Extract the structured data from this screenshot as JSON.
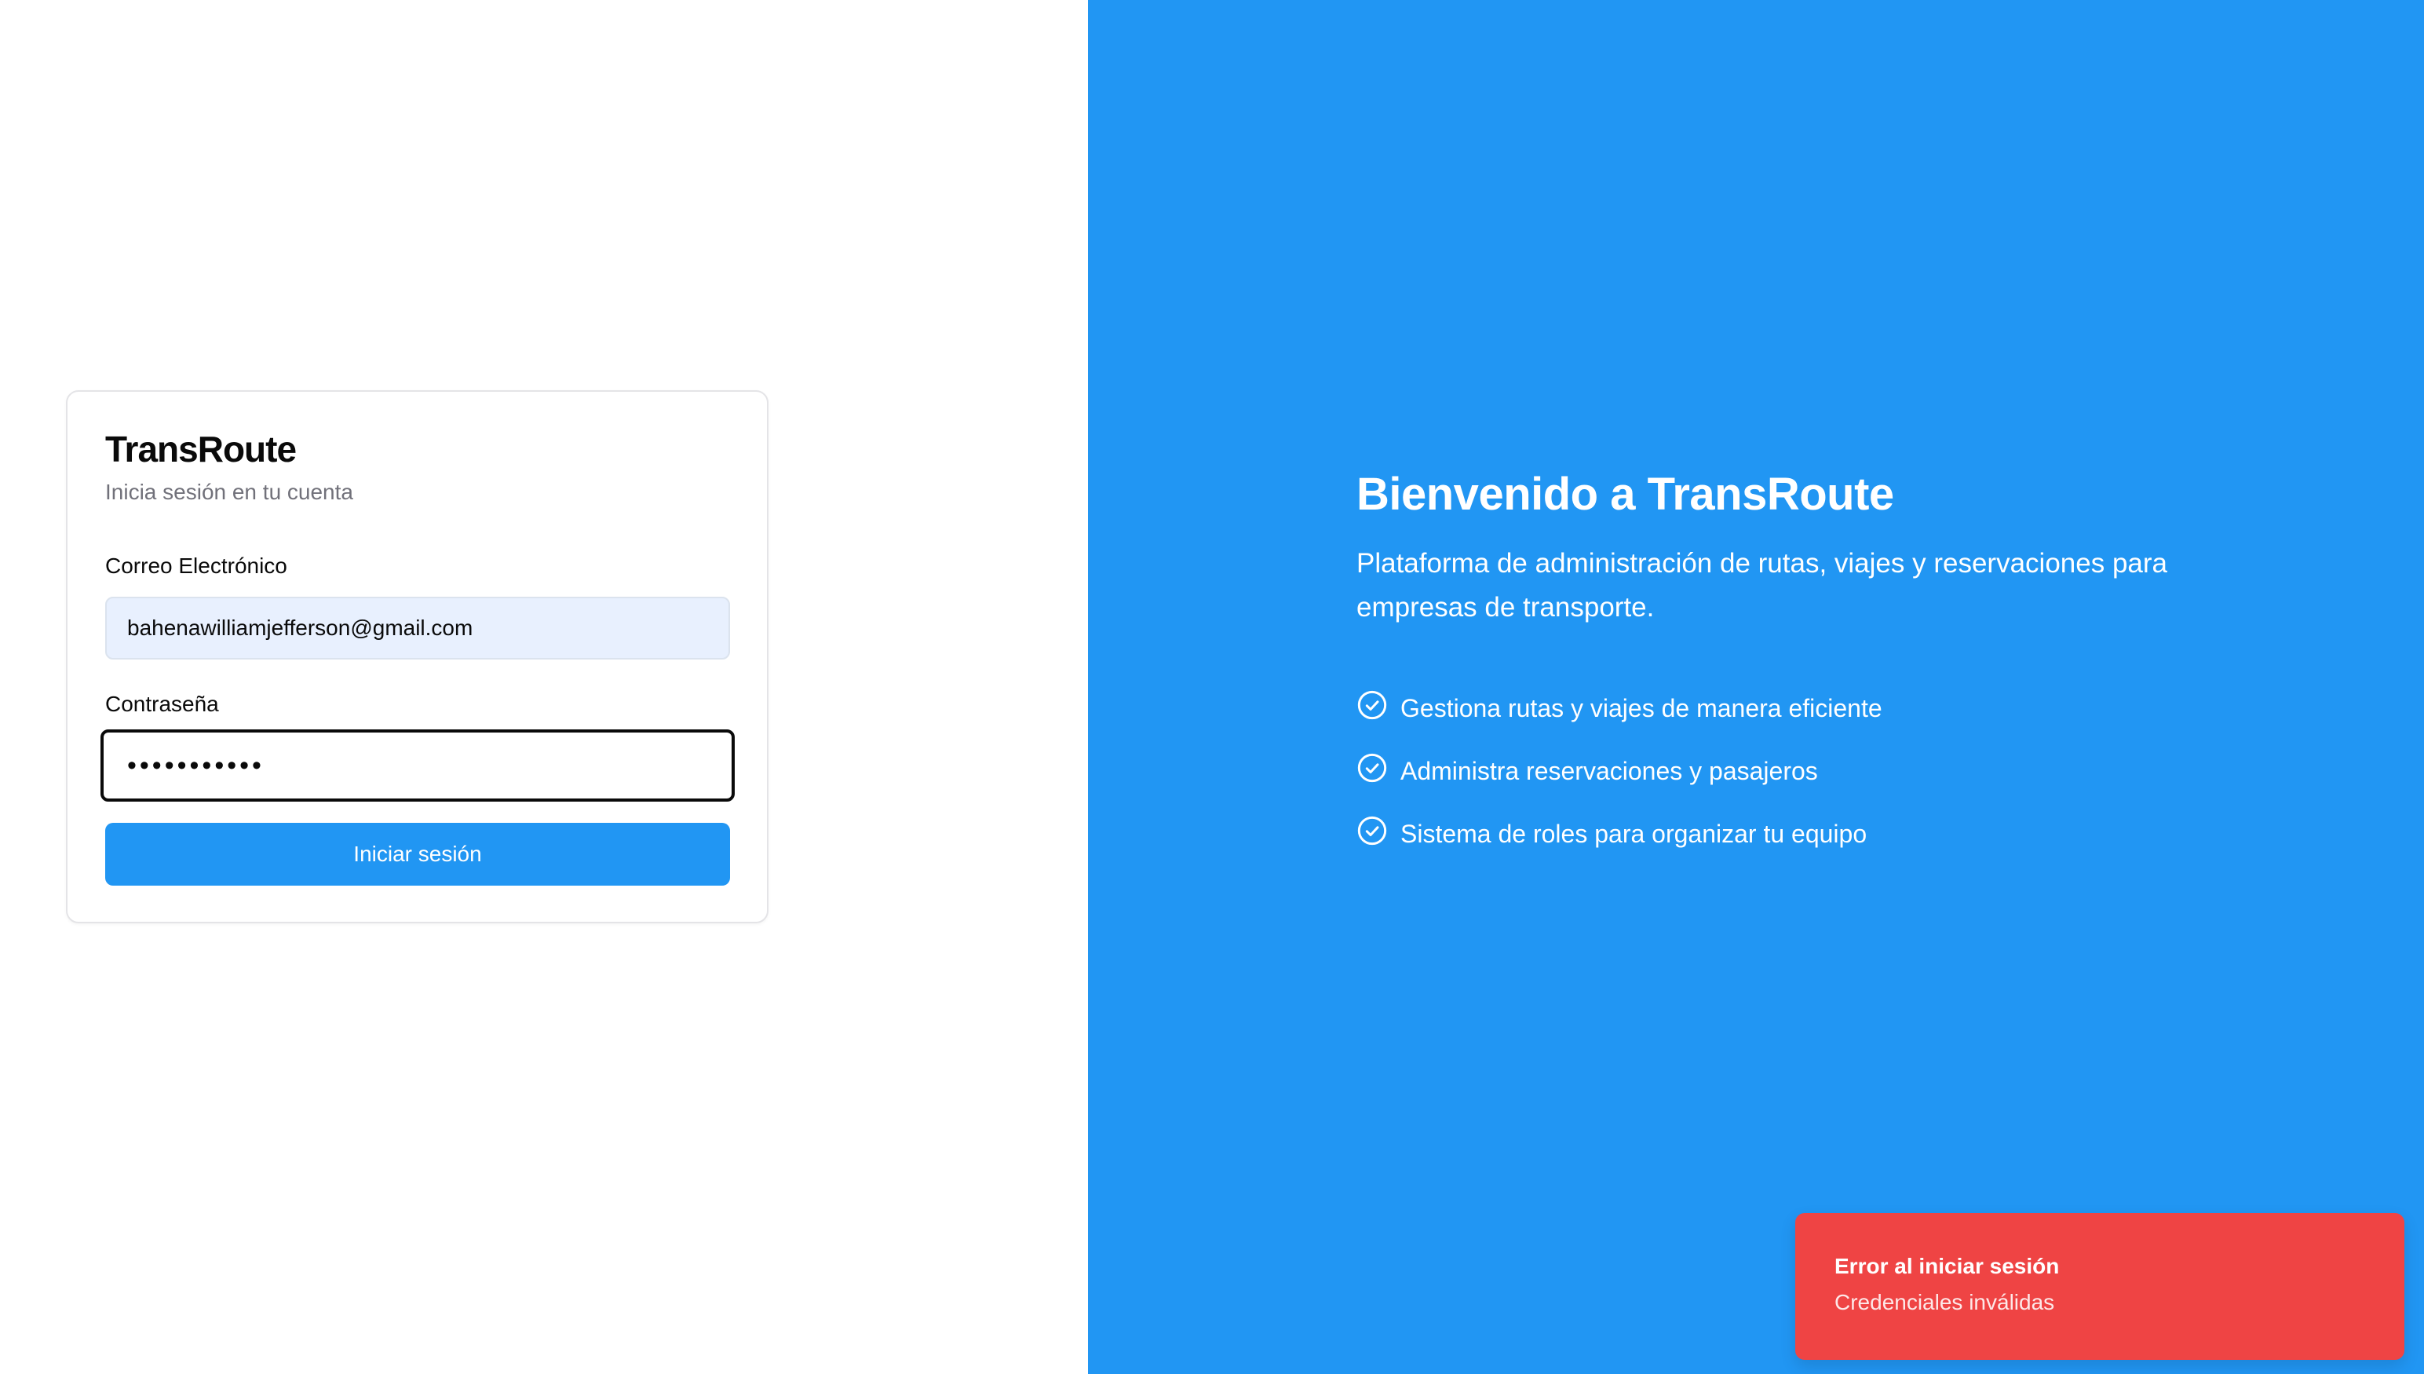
{
  "login": {
    "app_name": "TransRoute",
    "subtitle": "Inicia sesión en tu cuenta",
    "email_label": "Correo Electrónico",
    "email_value": "bahenawilliamjefferson@gmail.com",
    "password_label": "Contraseña",
    "password_value": "•••••••••••",
    "submit_label": "Iniciar sesión"
  },
  "hero": {
    "title": "Bienvenido a TransRoute",
    "description": "Plataforma de administración de rutas, viajes y reservaciones para empresas de transporte.",
    "features": [
      {
        "icon": "check-circle-icon",
        "label": "Gestiona rutas y viajes de manera eficiente"
      },
      {
        "icon": "check-circle-icon",
        "label": "Administra reservaciones y pasajeros"
      },
      {
        "icon": "check-circle-icon",
        "label": "Sistema de roles para organizar tu equipo"
      }
    ]
  },
  "toast": {
    "title": "Error al iniciar sesión",
    "description": "Credenciales inválidas"
  },
  "colors": {
    "brand_blue": "#2196f3",
    "error_red": "#ef4444",
    "autofill_bg": "#e8f0fe"
  }
}
